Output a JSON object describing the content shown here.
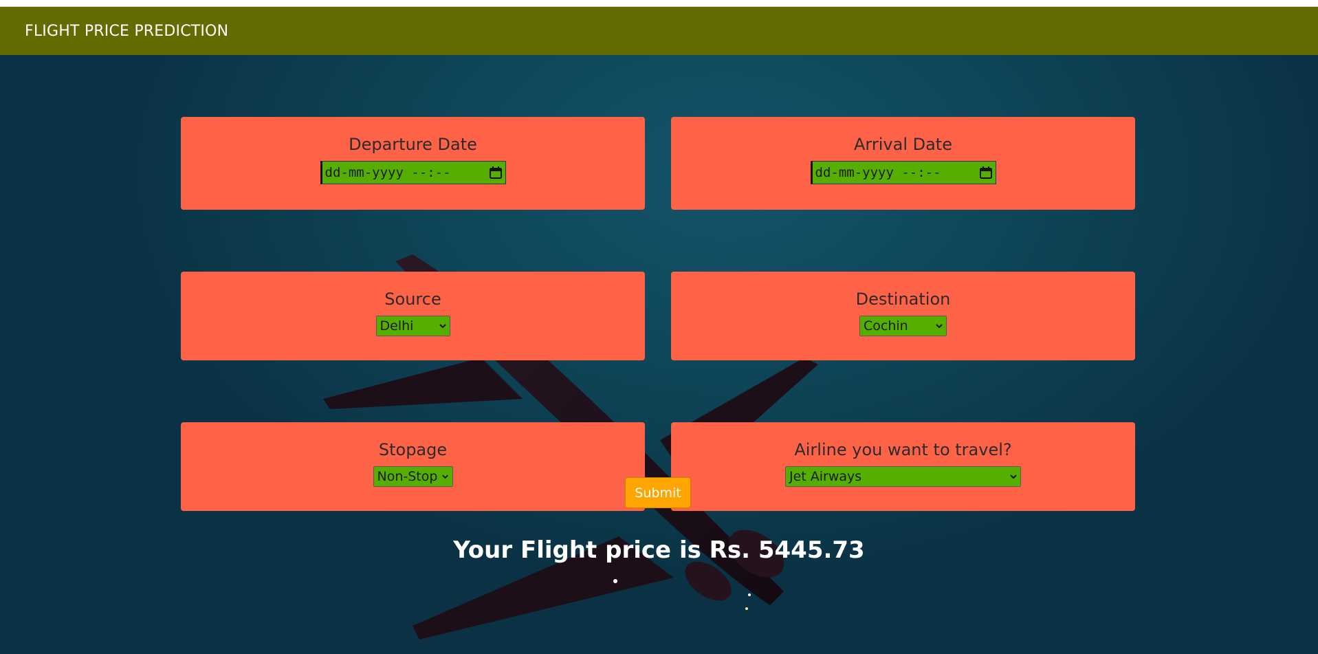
{
  "header": {
    "title": "FLIGHT PRICE PREDICTION"
  },
  "form": {
    "departure": {
      "label": "Departure Date",
      "placeholder": "dd-mm-yyyy --:--"
    },
    "arrival": {
      "label": "Arrival Date",
      "placeholder": "dd-mm-yyyy --:--"
    },
    "source": {
      "label": "Source",
      "selected": "Delhi"
    },
    "destination": {
      "label": "Destination",
      "selected": "Cochin"
    },
    "stopage": {
      "label": "Stopage",
      "selected": "Non-Stop"
    },
    "airline": {
      "label": "Airline you want to travel?",
      "selected": "Jet Airways"
    },
    "submit_label": "Submit"
  },
  "result": {
    "text": "Your Flight price is Rs. 5445.73"
  },
  "icons": {
    "date_picker": "calendar-icon",
    "dropdown": "chevron-down-icon"
  },
  "colors": {
    "navbar": "#636b00",
    "card": "#ff6347",
    "field": "#56ae00",
    "submit": "#ffa500",
    "background": "#0f4659"
  }
}
